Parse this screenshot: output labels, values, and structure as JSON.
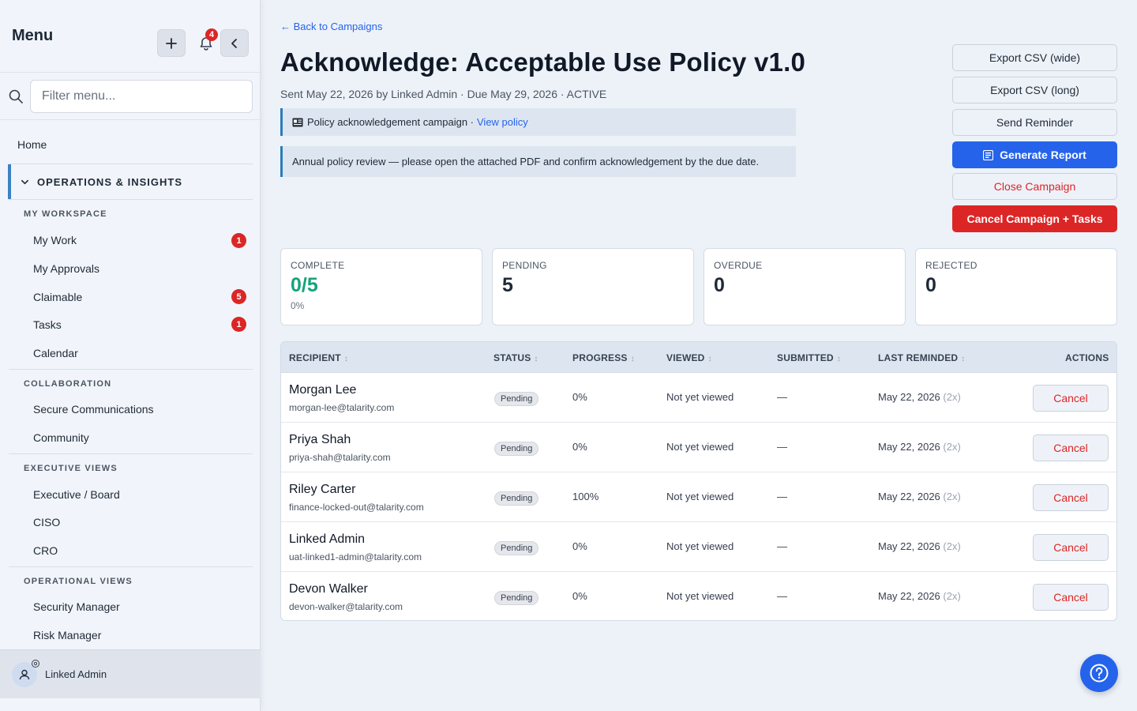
{
  "sidebar": {
    "title": "Menu",
    "notification_count": "4",
    "search_placeholder": "Filter menu...",
    "home": "Home",
    "section": "OPERATIONS & INSIGHTS",
    "groups": {
      "workspace": "MY WORKSPACE",
      "collaboration": "COLLABORATION",
      "executive": "EXECUTIVE VIEWS",
      "operational": "OPERATIONAL VIEWS"
    },
    "items": {
      "my_work": {
        "label": "My Work",
        "badge": "1"
      },
      "my_approvals": {
        "label": "My Approvals"
      },
      "claimable": {
        "label": "Claimable",
        "badge": "5"
      },
      "tasks": {
        "label": "Tasks",
        "badge": "1"
      },
      "calendar": {
        "label": "Calendar"
      },
      "secure_comms": {
        "label": "Secure Communications"
      },
      "community": {
        "label": "Community"
      },
      "exec_board": {
        "label": "Executive / Board"
      },
      "ciso": {
        "label": "CISO"
      },
      "cro": {
        "label": "CRO"
      },
      "security_manager": {
        "label": "Security Manager"
      },
      "risk_manager": {
        "label": "Risk Manager"
      }
    },
    "user": "Linked Admin"
  },
  "header": {
    "back": "← Back to Campaigns",
    "title": "Acknowledge: Acceptable Use Policy v1.0",
    "subtitle": "Sent May 22, 2026 by Linked Admin · Due May 29, 2026 · ACTIVE",
    "campaign_type": "Policy acknowledgement campaign ·",
    "view_policy": "View policy",
    "message": "Annual policy review — please open the attached PDF and confirm acknowledgement by the due date."
  },
  "actions": {
    "export_wide": "Export CSV (wide)",
    "export_long": "Export CSV (long)",
    "send_reminder": "Send Reminder",
    "generate_report": "Generate Report",
    "close_campaign": "Close Campaign",
    "cancel_all": "Cancel Campaign + Tasks"
  },
  "stats": {
    "complete": {
      "label": "COMPLETE",
      "value": "0/5",
      "sub": "0%"
    },
    "pending": {
      "label": "PENDING",
      "value": "5"
    },
    "overdue": {
      "label": "OVERDUE",
      "value": "0"
    },
    "rejected": {
      "label": "REJECTED",
      "value": "0"
    }
  },
  "table": {
    "columns": {
      "recipient": "RECIPIENT",
      "status": "STATUS",
      "progress": "PROGRESS",
      "viewed": "VIEWED",
      "submitted": "SUBMITTED",
      "last_reminded": "LAST REMINDED",
      "actions": "ACTIONS"
    },
    "sort_glyph": "↕",
    "rows": [
      {
        "name": "Morgan Lee",
        "email": "morgan-lee@talarity.com",
        "status": "Pending",
        "progress": "0%",
        "viewed": "Not yet viewed",
        "submitted": "—",
        "reminded": "May 22, 2026",
        "count": "(2x)",
        "action": "Cancel"
      },
      {
        "name": "Priya Shah",
        "email": "priya-shah@talarity.com",
        "status": "Pending",
        "progress": "0%",
        "viewed": "Not yet viewed",
        "submitted": "—",
        "reminded": "May 22, 2026",
        "count": "(2x)",
        "action": "Cancel"
      },
      {
        "name": "Riley Carter",
        "email": "finance-locked-out@talarity.com",
        "status": "Pending",
        "progress": "100%",
        "viewed": "Not yet viewed",
        "submitted": "—",
        "reminded": "May 22, 2026",
        "count": "(2x)",
        "action": "Cancel"
      },
      {
        "name": "Linked Admin",
        "email": "uat-linked1-admin@talarity.com",
        "status": "Pending",
        "progress": "0%",
        "viewed": "Not yet viewed",
        "submitted": "—",
        "reminded": "May 22, 2026",
        "count": "(2x)",
        "action": "Cancel"
      },
      {
        "name": "Devon Walker",
        "email": "devon-walker@talarity.com",
        "status": "Pending",
        "progress": "0%",
        "viewed": "Not yet viewed",
        "submitted": "—",
        "reminded": "May 22, 2026",
        "count": "(2x)",
        "action": "Cancel"
      }
    ]
  },
  "colors": {
    "accent": "#2563eb",
    "danger": "#dc2626",
    "success": "#16a37a"
  }
}
